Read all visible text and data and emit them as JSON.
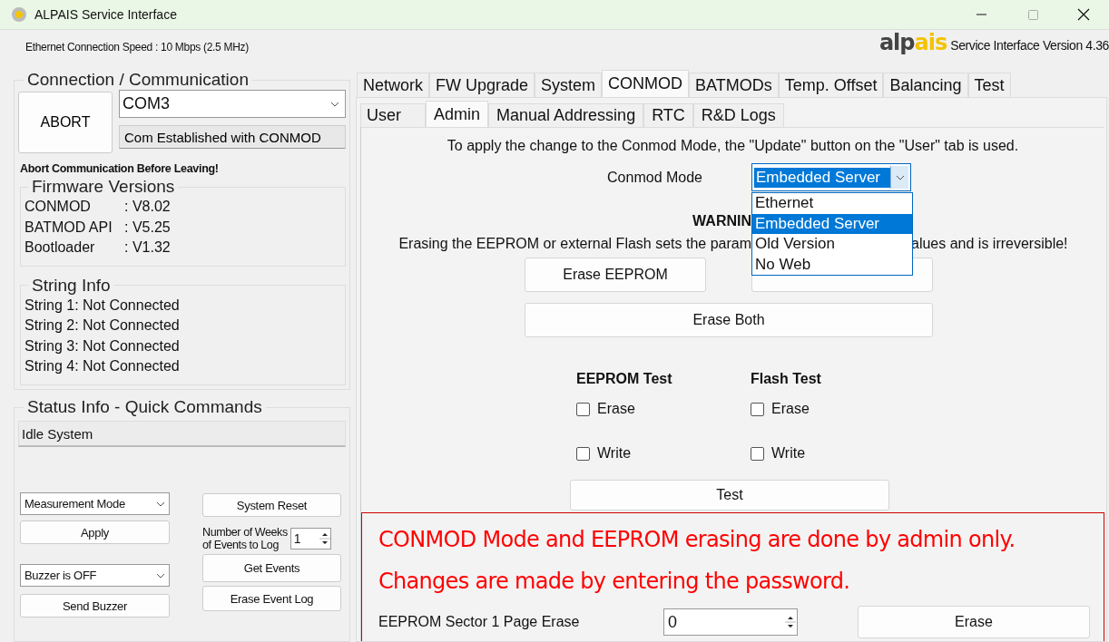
{
  "window": {
    "title": "ALPAIS Service Interface"
  },
  "header": {
    "speed": "Ethernet Connection Speed : 10 Mbps (2.5 MHz)",
    "logo": [
      "alp",
      "ais"
    ],
    "version": "Service Interface Version 4.36"
  },
  "connection": {
    "title": "Connection / Communication",
    "abort": "ABORT",
    "port": "COM3",
    "status": "Com Established with CONMOD",
    "warning": "Abort Communication Before Leaving!"
  },
  "firmware": {
    "title": "Firmware Versions",
    "rows": [
      {
        "name": "CONMOD",
        "value": ": V8.02"
      },
      {
        "name": "BATMOD API",
        "value": ": V5.25"
      },
      {
        "name": "Bootloader",
        "value": ": V1.32"
      }
    ]
  },
  "string_info": {
    "title": "String Info",
    "items": [
      "String 1: Not Connected",
      "String 2: Not Connected",
      "String 3: Not Connected",
      "String 4: Not Connected"
    ]
  },
  "status": {
    "title": "Status Info - Quick Commands",
    "state": "Idle System",
    "mode": "Measurement Mode",
    "apply": "Apply",
    "buzzer": "Buzzer is OFF",
    "send_buzzer": "Send Buzzer",
    "system_reset": "System Reset",
    "weeks_label": [
      "Number of Weeks",
      "of Events to Log"
    ],
    "weeks_value": "1",
    "get_events": "Get Events",
    "erase_log": "Erase Event Log"
  },
  "tabs": [
    {
      "label": "Network",
      "selected": false
    },
    {
      "label": "FW Upgrade",
      "selected": false
    },
    {
      "label": "System",
      "selected": false
    },
    {
      "label": "CONMOD",
      "selected": true
    },
    {
      "label": "BATMODs",
      "selected": false
    },
    {
      "label": "Temp. Offset",
      "selected": false
    },
    {
      "label": "Balancing",
      "selected": false
    },
    {
      "label": "Test",
      "selected": false
    }
  ],
  "subtabs": [
    {
      "label": "User",
      "selected": false
    },
    {
      "label": "Admin",
      "selected": true
    },
    {
      "label": "Manual Addressing",
      "selected": false
    },
    {
      "label": "RTC",
      "selected": false
    },
    {
      "label": "R&D Logs",
      "selected": false
    }
  ],
  "admin": {
    "note": "To apply the change to the Conmod Mode, the \"Update\" button on the \"User\" tab is used.",
    "conmod_label": "Conmod Mode",
    "conmod_value": "Embedded Server",
    "options": [
      {
        "label": "Ethernet",
        "selected": false
      },
      {
        "label": "Embedded Server",
        "selected": true
      },
      {
        "label": "Old Version",
        "selected": false
      },
      {
        "label": "No Web",
        "selected": false
      }
    ],
    "warning_title": "WARNIN",
    "warning_left": "Erasing the EEPROM or external Flash sets the param",
    "warning_right": "alues and is irreversible!",
    "erase_eeprom": "Erase EEPROM",
    "erase_both": "Erase Both",
    "tests": [
      {
        "title": "EEPROM Test",
        "options": [
          {
            "label": "Erase",
            "checked": false
          },
          {
            "label": "Write",
            "checked": false
          }
        ]
      },
      {
        "title": "Flash Test",
        "options": [
          {
            "label": "Erase",
            "checked": false
          },
          {
            "label": "Write",
            "checked": false
          }
        ]
      }
    ],
    "test_button": "Test",
    "notice": "CONMOD Mode and EEPROM erasing are done by admin only. Changes are made by entering the password.",
    "sector_label": "EEPROM Sector 1 Page Erase",
    "sector_value": "0",
    "erase": "Erase"
  }
}
